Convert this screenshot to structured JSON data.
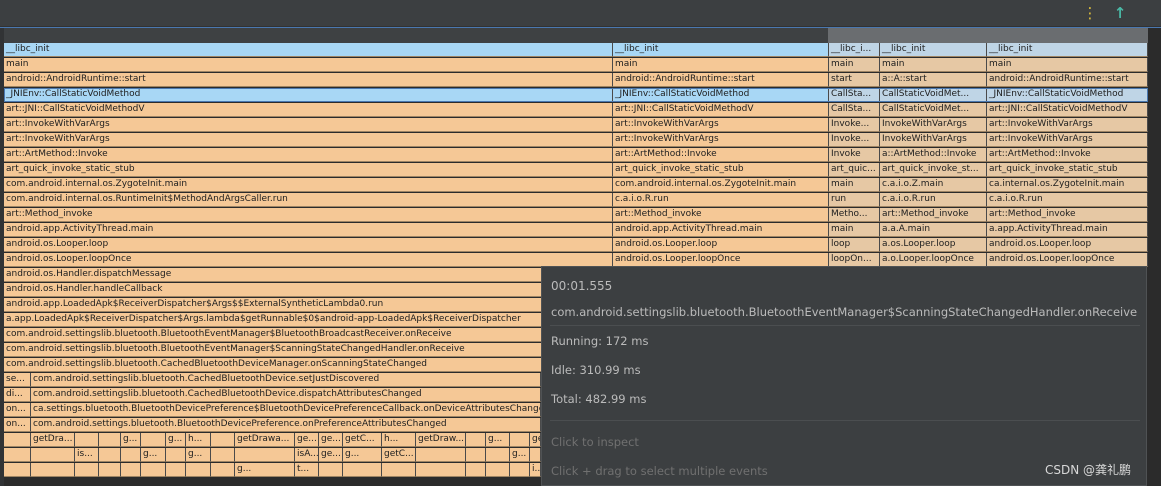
{
  "toolbar": {
    "kebab_glyph": "⋮",
    "kebab_icon": "more-vert-icon",
    "up_glyph": "↑",
    "up_icon": "arrow-up-icon"
  },
  "colors": {
    "blue": "#a8d7f5",
    "orange": "#f5c896",
    "muted_blue": "#bfd5e6",
    "muted_orange": "#e6c8a4",
    "highlight": "#4a78b0"
  },
  "flame": {
    "main_rows": [
      "__libc_init",
      "main",
      "android::AndroidRuntime::start",
      "_JNIEnv::CallStaticVoidMethod",
      "art::JNI::CallStaticVoidMethodV",
      "art::InvokeWithVarArgs",
      "art::InvokeWithVarArgs",
      "art::ArtMethod::Invoke",
      "art_quick_invoke_static_stub",
      "com.android.internal.os.ZygoteInit.main",
      "com.android.internal.os.RuntimeInit$MethodAndArgsCaller.run",
      "art::Method_invoke",
      "android.app.ActivityThread.main",
      "android.os.Looper.loop",
      "android.os.Looper.loopOnce",
      "android.os.Handler.dispatchMessage",
      "android.os.Handler.handleCallback",
      "android.app.LoadedApk$ReceiverDispatcher$Args$$ExternalSyntheticLambda0.run",
      "a.app.LoadedApk$ReceiverDispatcher$Args.lambda$getRunnable$0$android-app-LoadedApk$ReceiverDispatcher",
      "com.android.settingslib.bluetooth.BluetoothEventManager$BluetoothBroadcastReceiver.onReceive",
      "com.android.settingslib.bluetooth.BluetoothEventManager$ScanningStateChangedHandler.onReceive",
      "com.android.settingslib.bluetooth.CachedBluetoothDeviceManager.onScanningStateChanged"
    ],
    "right_columns": [
      [
        "__libc_init",
        "main",
        "android::AndroidRuntime::start",
        "_JNIEnv::CallStaticVoidMethod",
        "art::JNI::CallStaticVoidMethodV",
        "art::InvokeWithVarArgs",
        "art::InvokeWithVarArgs",
        "art::ArtMethod::Invoke",
        "art_quick_invoke_static_stub",
        "com.android.internal.os.ZygoteInit.main",
        "c.a.i.o.R.run",
        "art::Method_invoke",
        "android.app.ActivityThread.main",
        "android.os.Looper.loop",
        "android.os.Looper.loopOnce"
      ],
      [
        "__libc_i...",
        "main",
        "start",
        "CallSta...",
        "CallSta...",
        "Invoke...",
        "Invoke...",
        "Invoke",
        "art_quic...",
        "main",
        "run",
        "Metho...",
        "main",
        "loop",
        "loopOn..."
      ],
      [
        "__libc_init",
        "main",
        "a::A::start",
        "CallStaticVoidMet...",
        "CallStaticVoidMet...",
        "InvokeWithVarArgs",
        "InvokeWithVarArgs",
        "a::ArtMethod::Invoke",
        "art_quick_invoke_st...",
        "c.a.i.o.Z.main",
        "c.a.i.o.R.run",
        "art::Method_invoke",
        "a.a.A.main",
        "a.os.Looper.loop",
        "a.o.Looper.loopOnce"
      ],
      [
        "__libc_init",
        "main",
        "android::AndroidRuntime::start",
        "_JNIEnv::CallStaticVoidMethod",
        "art::JNI::CallStaticVoidMethodV",
        "art::InvokeWithVarArgs",
        "art::InvokeWithVarArgs",
        "art::ArtMethod::Invoke",
        "art_quick_invoke_static_stub",
        "ca.internal.os.ZygoteInit.main",
        "c.a.i.o.R.run",
        "art::Method_invoke",
        "a.app.ActivityThread.main",
        "android.os.Looper.loop",
        "android.os.Looper.loopOnce"
      ]
    ],
    "deep_rows": [
      [
        [
          "se...",
          1
        ],
        [
          "com.android.settingslib.bluetooth.CachedBluetoothDevice.setJustDiscovered",
          0
        ]
      ],
      [
        [
          "di...",
          1
        ],
        [
          "com.android.settingslib.bluetooth.CachedBluetoothDevice.dispatchAttributesChanged",
          0
        ]
      ],
      [
        [
          "on...",
          1
        ],
        [
          "ca.settings.bluetooth.BluetoothDevicePreference$BluetoothDevicePreferenceCallback.onDeviceAttributesChanged",
          0
        ]
      ],
      [
        [
          "on...",
          1
        ],
        [
          "com.android.settings.bluetooth.BluetoothDevicePreference.onPreferenceAttributesChanged",
          0
        ]
      ],
      [
        [
          "",
          1
        ],
        [
          "getDra...",
          0
        ],
        [
          "",
          1
        ],
        [
          "",
          1
        ],
        [
          "g...",
          0
        ],
        [
          "",
          1
        ],
        [
          "g...",
          0
        ],
        [
          "h...",
          0
        ],
        [
          "",
          1
        ],
        [
          "getDrawa...",
          0
        ],
        [
          "ge...",
          0
        ],
        [
          "ge...",
          0
        ],
        [
          "getC...",
          0
        ],
        [
          "h...",
          0
        ],
        [
          "getDraw...",
          0
        ],
        [
          "",
          1
        ],
        [
          "g...",
          0
        ],
        [
          "",
          1
        ],
        [
          "getC...",
          0
        ],
        [
          "ha...",
          0
        ],
        [
          "getDra",
          0
        ]
      ],
      [
        [
          "",
          1
        ],
        [
          "",
          0
        ],
        [
          "is...",
          0
        ],
        [
          "",
          1
        ],
        [
          "",
          1
        ],
        [
          "g...",
          0
        ],
        [
          "",
          1
        ],
        [
          "g...",
          0
        ],
        [
          "",
          1
        ],
        [
          "",
          0
        ],
        [
          "isA...",
          0
        ],
        [
          "ge...",
          0
        ],
        [
          "g...",
          0
        ],
        [
          "getC...",
          0
        ],
        [
          "",
          1
        ],
        [
          "",
          0
        ],
        [
          "",
          1
        ],
        [
          "g...",
          0
        ],
        [
          "",
          1
        ],
        [
          "getC...",
          0
        ],
        [
          "ge...",
          0
        ],
        [
          "",
          1
        ],
        [
          "",
          0
        ]
      ],
      [
        [
          "",
          1
        ],
        [
          "",
          1
        ],
        [
          "",
          0
        ],
        [
          "",
          1
        ],
        [
          "",
          1
        ],
        [
          "",
          1
        ],
        [
          "",
          1
        ],
        [
          "",
          1
        ],
        [
          "",
          0
        ],
        [
          "g...",
          0
        ],
        [
          "t...",
          0
        ],
        [
          "",
          1
        ],
        [
          "",
          1
        ],
        [
          "",
          1
        ],
        [
          "",
          1
        ],
        [
          "",
          1
        ],
        [
          "",
          1
        ],
        [
          "",
          1
        ],
        [
          "i...",
          0
        ],
        [
          "",
          1
        ],
        [
          "",
          1
        ],
        [
          "",
          1
        ],
        [
          "",
          1
        ]
      ]
    ]
  },
  "tooltip": {
    "time": "00:01.555",
    "method": "com.android.settingslib.bluetooth.BluetoothEventManager$ScanningStateChangedHandler.onReceive",
    "running": "Running: 172 ms",
    "idle": "Idle: 310.99 ms",
    "total": "Total: 482.99 ms",
    "hint_inspect": "Click to inspect",
    "hint_drag": "Click + drag to select multiple events"
  },
  "watermark": "CSDN @龚礼鹏"
}
